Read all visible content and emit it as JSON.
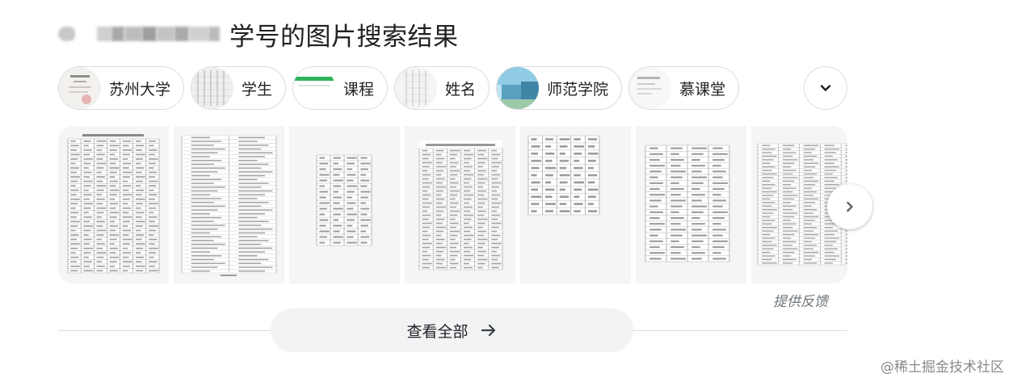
{
  "header": {
    "title": "学号的图片搜索结果"
  },
  "chips": [
    {
      "label": "苏州大学",
      "icon": "document-thumb-icon"
    },
    {
      "label": "学生",
      "icon": "table-thumb-icon"
    },
    {
      "label": "课程",
      "icon": "green-header-thumb-icon"
    },
    {
      "label": "姓名",
      "icon": "table-thumb-icon"
    },
    {
      "label": "师范学院",
      "icon": "campus-photo-thumb-icon"
    },
    {
      "label": "慕课堂",
      "icon": "document-thumb-icon"
    }
  ],
  "chips_expand": {
    "icon": "chevron-down-icon"
  },
  "images": [
    {
      "kind": "dense-table"
    },
    {
      "kind": "list-table"
    },
    {
      "kind": "small-table"
    },
    {
      "kind": "dense-table"
    },
    {
      "kind": "partial-table"
    },
    {
      "kind": "list-table"
    },
    {
      "kind": "wide-table"
    }
  ],
  "next": {
    "icon": "chevron-right-icon"
  },
  "feedback": {
    "label": "提供反馈"
  },
  "view_all": {
    "label": "查看全部",
    "icon": "arrow-right-icon"
  },
  "watermark": {
    "text": "@稀土掘金技术社区"
  },
  "colors": {
    "chip_border": "#dadce0",
    "button_bg": "#f1f3f4",
    "text": "#202124",
    "muted": "#70757a"
  }
}
